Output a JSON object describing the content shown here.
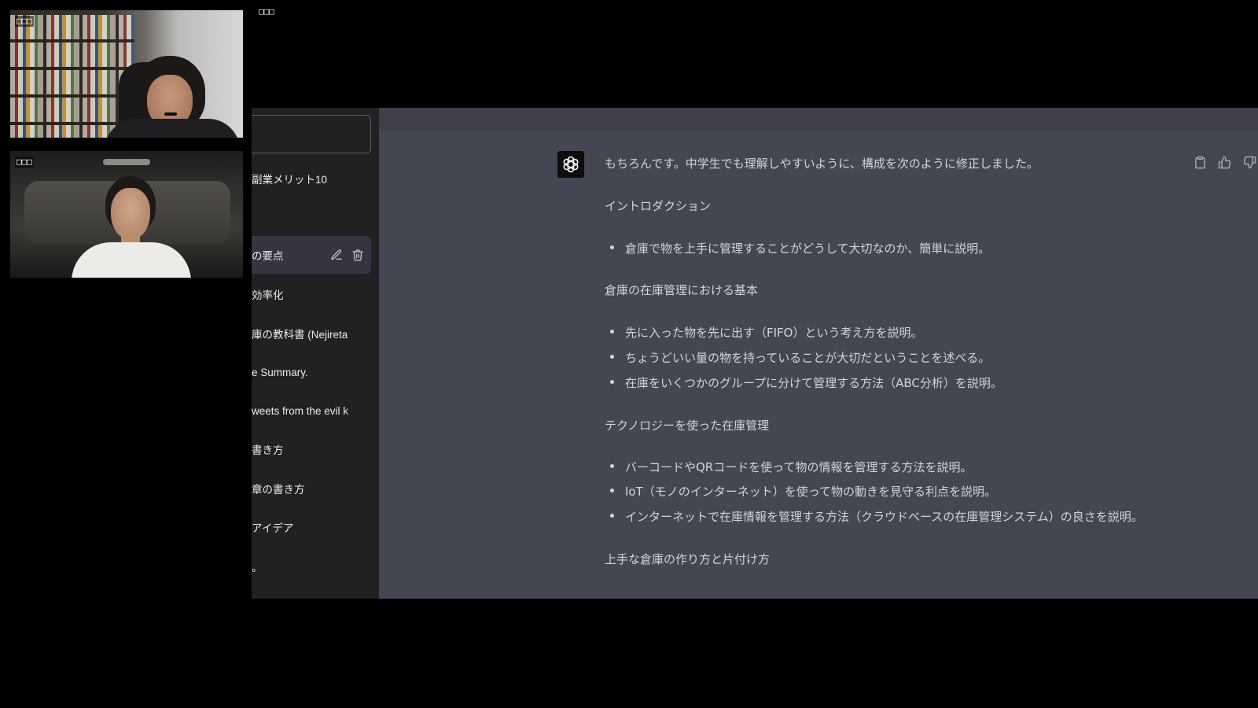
{
  "meeting": {
    "presenter_label": "□□□",
    "participants": [
      {
        "name_label": "□□□"
      },
      {
        "name_label": "□□□"
      }
    ]
  },
  "sidebar": {
    "items": [
      {
        "label": "副業メリット10"
      },
      {
        "label": "の要点",
        "selected": true,
        "actions": [
          "pencil-icon",
          "trash-icon"
        ]
      },
      {
        "label": "効率化"
      },
      {
        "label": "庫の教科書 (Nejireta"
      },
      {
        "label": "e Summary."
      },
      {
        "label": "weets from the evil k"
      },
      {
        "label": "書き方"
      },
      {
        "label": "章の書き方"
      },
      {
        "label": "アイデア"
      },
      {
        "label": "。"
      }
    ]
  },
  "message": {
    "avatar_icon": "chatgpt-logo-icon",
    "intro": "もちろんです。中学生でも理解しやすいように、構成を次のように修正しました。",
    "sections": [
      {
        "heading": "イントロダクション",
        "bullets": [
          "倉庫で物を上手に管理することがどうして大切なのか、簡単に説明。"
        ]
      },
      {
        "heading": "倉庫の在庫管理における基本",
        "bullets": [
          "先に入った物を先に出す（FIFO）という考え方を説明。",
          "ちょうどいい量の物を持っていることが大切だということを述べる。",
          "在庫をいくつかのグループに分けて管理する方法（ABC分析）を説明。"
        ]
      },
      {
        "heading": "テクノロジーを使った在庫管理",
        "bullets": [
          "バーコードやQRコードを使って物の情報を管理する方法を説明。",
          "IoT（モノのインターネット）を使って物の動きを見守る利点を説明。",
          "インターネットで在庫情報を管理する方法（クラウドベースの在庫管理システム）の良さを説明。"
        ]
      },
      {
        "heading": "上手な倉庫の作り方と片付け方",
        "bullets": []
      }
    ]
  },
  "message_actions": [
    {
      "icon": "clipboard-icon"
    },
    {
      "icon": "thumbs-up-icon"
    },
    {
      "icon": "thumbs-down-icon"
    }
  ],
  "colors": {
    "sidebar_bg": "#202123",
    "main_bg": "#444654",
    "selected_item_bg": "#343541",
    "avatar_bg": "#0d0d0d",
    "text": "#d1d5db"
  }
}
